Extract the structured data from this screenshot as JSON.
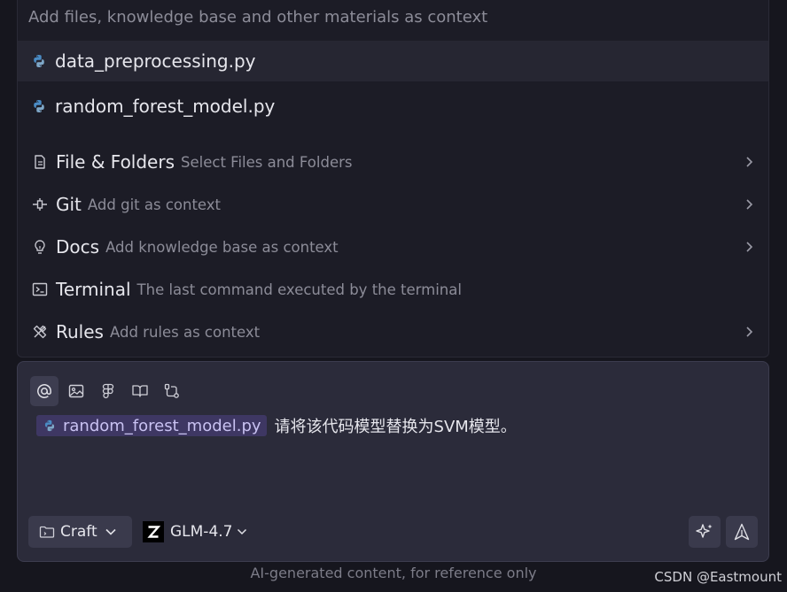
{
  "context_popup": {
    "placeholder": "Add files, knowledge base and other materials as context",
    "files": [
      {
        "name": "data_preprocessing.py",
        "selected": true
      },
      {
        "name": "random_forest_model.py",
        "selected": false
      }
    ],
    "items": [
      {
        "title": "File & Folders",
        "desc": "Select Files and Folders",
        "icon": "file-icon",
        "has_submenu": true
      },
      {
        "title": "Git",
        "desc": "Add git as context",
        "icon": "git-commit-icon",
        "has_submenu": true
      },
      {
        "title": "Docs",
        "desc": "Add knowledge base as context",
        "icon": "lightbulb-icon",
        "has_submenu": true
      },
      {
        "title": "Terminal",
        "desc": "The last command executed by the terminal",
        "icon": "terminal-icon",
        "has_submenu": false
      },
      {
        "title": "Rules",
        "desc": "Add rules as context",
        "icon": "rules-icon",
        "has_submenu": true
      }
    ]
  },
  "composer": {
    "toolbar": [
      {
        "icon": "at-mention-icon",
        "active": true
      },
      {
        "icon": "image-icon",
        "active": false
      },
      {
        "icon": "figma-icon",
        "active": false
      },
      {
        "icon": "book-icon",
        "active": false
      },
      {
        "icon": "workflow-icon",
        "active": false
      }
    ],
    "attached_file": "random_forest_model.py",
    "message": "请将该代码模型替换为SVM模型。",
    "mode_label": "Craft",
    "model_label": "GLM-4.7",
    "enhance_icon": "sparkle-icon",
    "send_icon": "send-icon"
  },
  "footer_note": "AI-generated content, for reference only",
  "watermark": "CSDN @Eastmount",
  "colors": {
    "background": "#16161e",
    "popup": "#1c1c26",
    "composer": "#2b2b3a",
    "chip": "#3e3763",
    "chip_text": "#c9c2f2",
    "python_blue": "#4a8bc4",
    "python_yellow": "#7fa8c9"
  }
}
